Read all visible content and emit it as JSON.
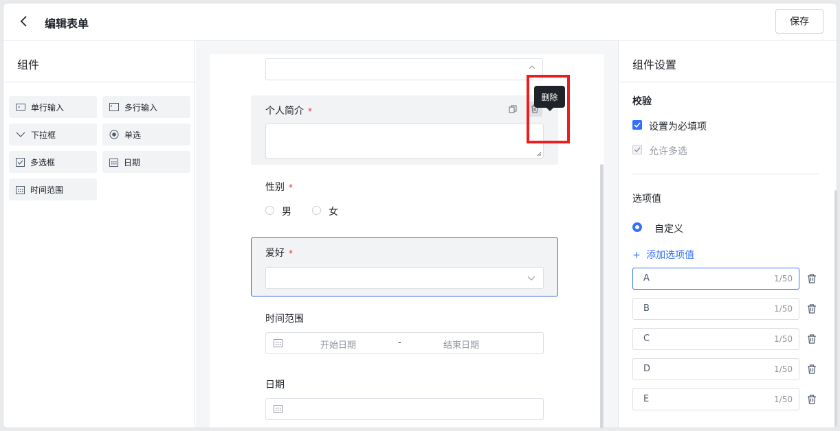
{
  "header": {
    "title": "编辑表单",
    "save_label": "保存"
  },
  "left_panel": {
    "title": "组件",
    "components": [
      {
        "label": "单行输入",
        "icon": "single-line-input-icon"
      },
      {
        "label": "多行输入",
        "icon": "multi-line-input-icon"
      },
      {
        "label": "下拉框",
        "icon": "chevron-down-icon"
      },
      {
        "label": "单选",
        "icon": "radio-icon"
      },
      {
        "label": "多选框",
        "icon": "checkbox-icon"
      },
      {
        "label": "日期",
        "icon": "calendar-icon"
      },
      {
        "label": "时间范围",
        "icon": "calendar-icon"
      }
    ]
  },
  "form": {
    "intro": {
      "label": "个人简介",
      "required": "*"
    },
    "tooltip": "删除",
    "gender": {
      "label": "性别",
      "required": "*",
      "options": [
        "男",
        "女"
      ]
    },
    "hobby": {
      "label": "爱好",
      "required": "*"
    },
    "time_range": {
      "label": "时间范围",
      "start_placeholder": "开始日期",
      "separator": "-",
      "end_placeholder": "结束日期"
    },
    "date": {
      "label": "日期"
    }
  },
  "right_panel": {
    "title": "组件设置",
    "validation_title": "校验",
    "required_label": "设置为必填项",
    "multi_label": "允许多选",
    "options_title": "选项值",
    "custom_label": "自定义",
    "add_option_label": "添加选项值",
    "options": [
      {
        "value": "A",
        "count": "1/50"
      },
      {
        "value": "B",
        "count": "1/50"
      },
      {
        "value": "C",
        "count": "1/50"
      },
      {
        "value": "D",
        "count": "1/50"
      },
      {
        "value": "E",
        "count": "1/50"
      }
    ]
  },
  "colors": {
    "accent": "#3370ff",
    "required": "#d9363e",
    "highlight": "#ee1c1c",
    "selected_border": "#3366cc"
  }
}
